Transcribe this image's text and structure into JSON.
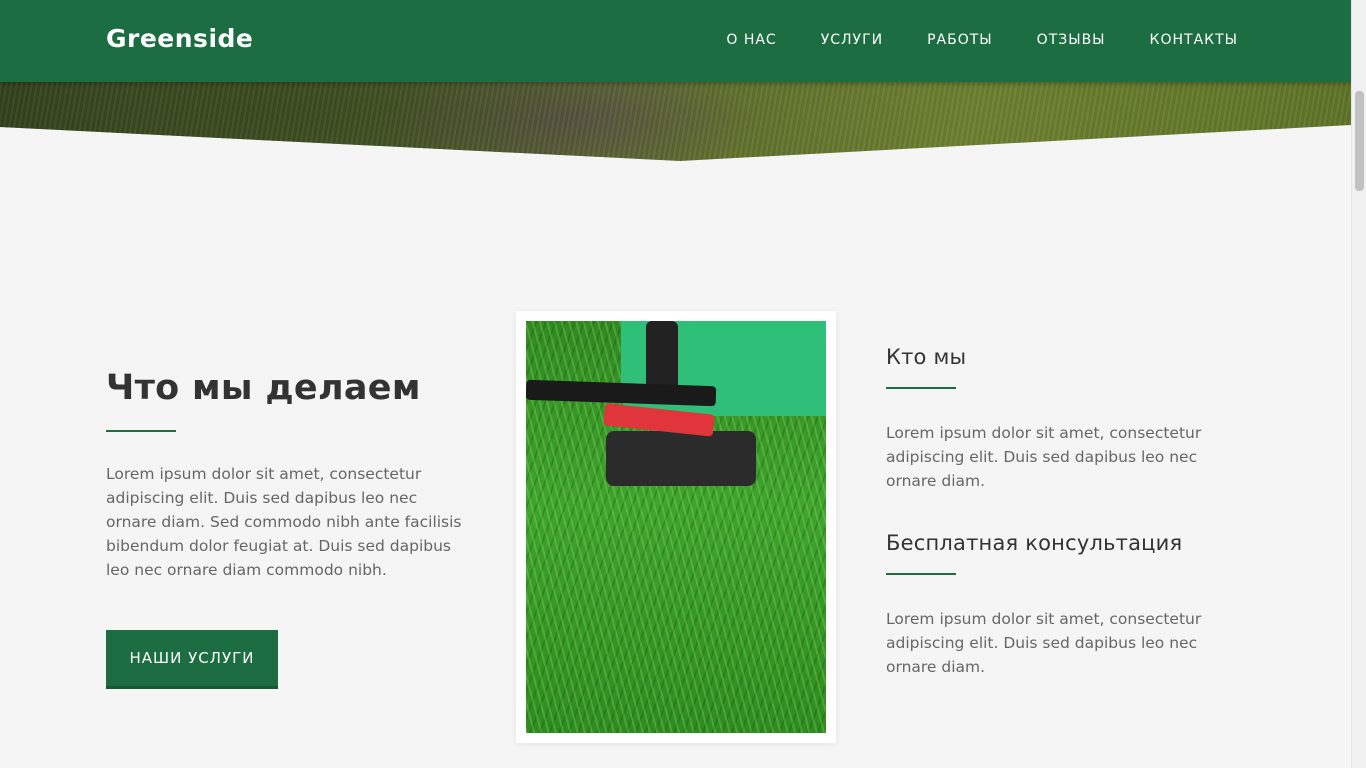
{
  "nav": {
    "brand": "Greenside",
    "items": [
      "О НАС",
      "УСЛУГИ",
      "РАБОТЫ",
      "ОТЗЫВЫ",
      "КОНТАКТЫ"
    ]
  },
  "what_we_do": {
    "title": "Что мы делаем",
    "text": "Lorem ipsum dolor sit amet, consectetur adipiscing elit. Duis sed dapibus leo nec ornare diam. Sed commodo nibh ante facilisis bibendum dolor feugiat at. Duis sed dapibus leo nec ornare diam commodo nibh.",
    "button_label": "НАШИ УСЛУГИ"
  },
  "who_we_are": {
    "title": "Кто мы",
    "text": "Lorem ipsum dolor sit amet, consectetur adipiscing elit. Duis sed dapibus leo nec ornare diam."
  },
  "free_consult": {
    "title": "Бесплатная консультация",
    "text": "Lorem ipsum dolor sit amet, consectetur adipiscing elit. Duis sed dapibus leo nec ornare diam."
  },
  "colors": {
    "brand_green": "#1c6e42",
    "background": "#f5f5f5"
  },
  "icons": [
    "lawn-mower-photo"
  ]
}
